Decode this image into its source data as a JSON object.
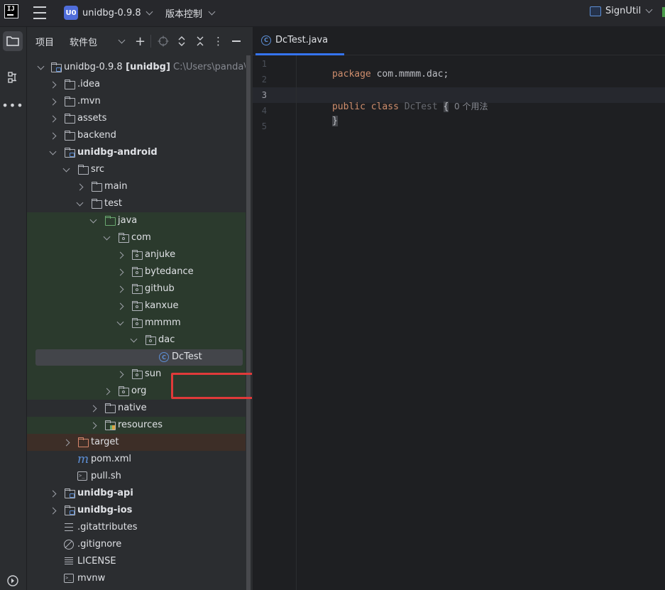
{
  "titlebar": {
    "logo_text": "IJ",
    "project_badge": "U0",
    "project_name": "unidbg-0.9.8",
    "vcs_label": "版本控制",
    "run_config": "SignUtil"
  },
  "panel": {
    "tab_project": "项目",
    "tab_packages": "软件包",
    "add_symbol": "+",
    "options_symbol": "⋮"
  },
  "tree": {
    "root_name": "unidbg-0.9.8",
    "root_module": " [unidbg]",
    "root_path": "  C:\\Users\\panda\\Deskt",
    "idea": ".idea",
    "mvn": ".mvn",
    "assets": "assets",
    "backend": "backend",
    "android": "unidbg-android",
    "src": "src",
    "main": "main",
    "test": "test",
    "java": "java",
    "com": "com",
    "anjuke": "anjuke",
    "bytedance": "bytedance",
    "github": "github",
    "kanxue": "kanxue",
    "mmmm": "mmmm",
    "dac": "dac",
    "dctest": "DcTest",
    "sun": "sun",
    "org": "org",
    "native": "native",
    "resources": "resources",
    "target": "target",
    "pom": "pom.xml",
    "pull": "pull.sh",
    "api": "unidbg-api",
    "ios": "unidbg-ios",
    "gitattributes": ".gitattributes",
    "gitignore": ".gitignore",
    "license": "LICENSE",
    "mvnw": "mvnw"
  },
  "editor": {
    "tab_label": "DcTest.java",
    "line_numbers": [
      "1",
      "2",
      "3",
      "4",
      "5"
    ],
    "kw_package": "package",
    "package_name": " com.mmmm.dac;",
    "kw_public": "public",
    "kw_class": " class",
    "class_name": " DcTest ",
    "open_brace": "{",
    "usages_hint": "  0 个用法",
    "close_brace": "}"
  },
  "icons": {
    "class": "C",
    "maven": "m",
    "shell": ">_"
  },
  "colors": {
    "accent": "#3574f0",
    "keyword": "#cf8e6d",
    "highlight_box": "#e03a3a",
    "test_root_bg": "#2b3a2d",
    "excluded_bg": "#3d2e27"
  }
}
